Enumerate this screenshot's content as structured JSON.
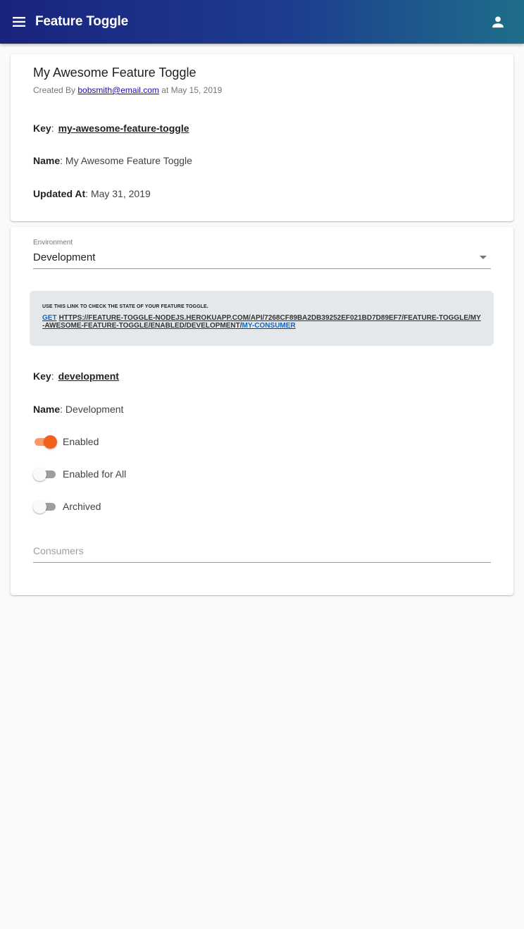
{
  "appbar": {
    "title": "Feature Toggle",
    "menu_icon": "menu-icon",
    "account_icon": "account-icon",
    "colors": {
      "gradient_start": "#1a237e",
      "gradient_end": "#1e6e8a"
    }
  },
  "toggle": {
    "title": "My Awesome Feature Toggle",
    "created_by_prefix": "Created By",
    "created_by_email": "bobsmith@email.com",
    "created_at_prefix": "at",
    "created_at": "May 15, 2019",
    "key_label": "Key",
    "key_value": "my-awesome-feature-toggle",
    "name_label": "Name",
    "name_value": "My Awesome Feature Toggle",
    "updated_label": "Updated At",
    "updated_value": "May 31, 2019"
  },
  "environment": {
    "select_label": "Environment",
    "selected": "Development",
    "info_header": "USE THIS LINK TO CHECK THE STATE OF YOUR FEATURE TOGGLE.",
    "link_method": "GET",
    "link_url": "HTTPS://FEATURE-TOGGLE-NODEJS.HEROKUAPP.COM/API/7268CF89BA2DB39252EF021BD7D89EF7/FEATURE-TOGGLE/MY-AWESOME-FEATURE-TOGGLE/ENABLED/DEVELOPMENT/",
    "link_consumer": "MY-CONSUMER",
    "key_label": "Key",
    "key_value": "development",
    "name_label": "Name",
    "name_value": "Development",
    "switches": [
      {
        "label": "Enabled",
        "on": true
      },
      {
        "label": "Enabled for All",
        "on": false
      },
      {
        "label": "Archived",
        "on": false
      }
    ],
    "consumers_placeholder": "Consumers",
    "colors": {
      "switch_on": "#f0611d",
      "link": "#1565c0"
    }
  }
}
